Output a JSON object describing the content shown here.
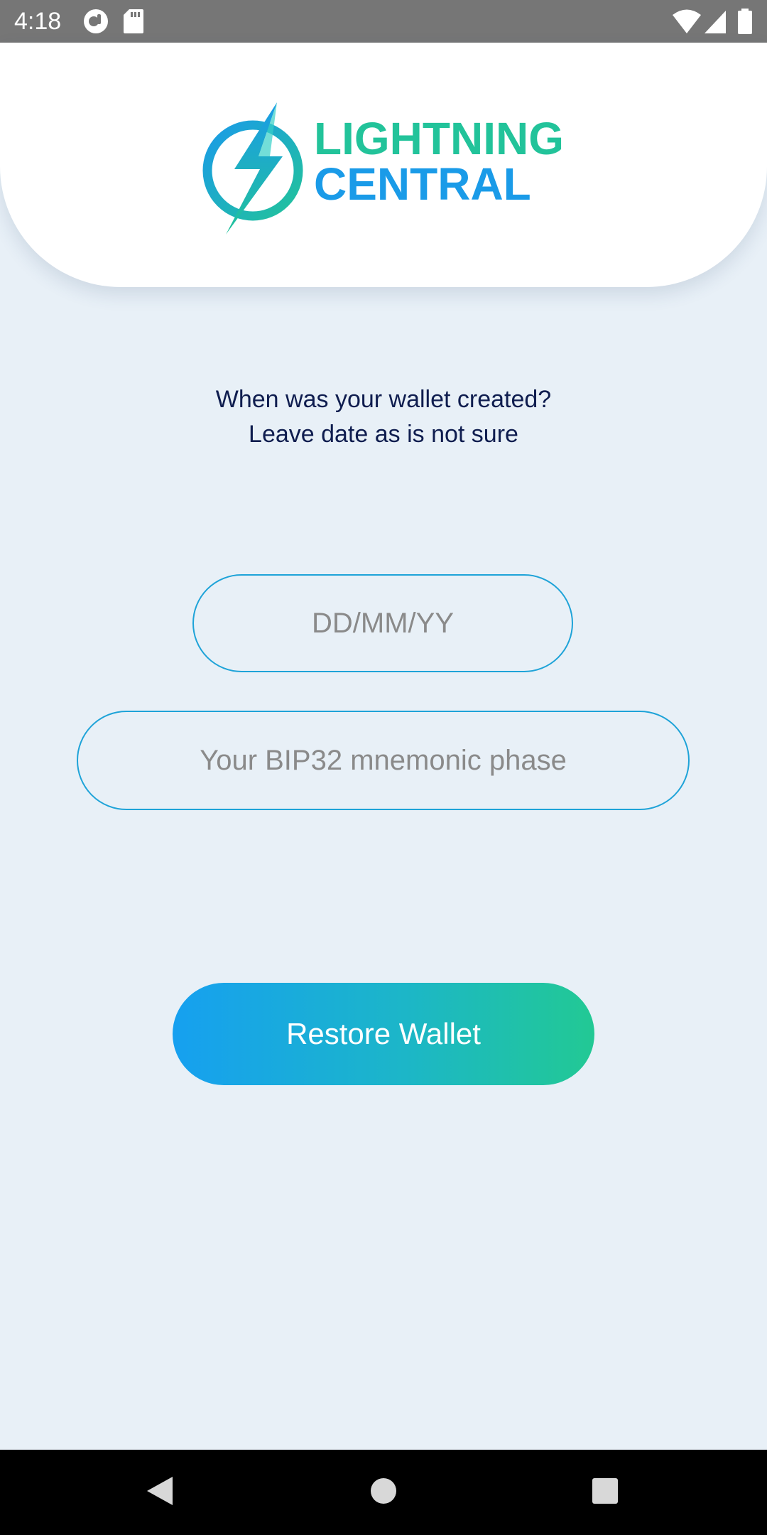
{
  "status_bar": {
    "time": "4:18",
    "left_icons": [
      "fdroid-icon",
      "sd-card-icon"
    ],
    "right_icons": [
      "wifi-icon",
      "cell-signal-icon",
      "battery-icon"
    ]
  },
  "header": {
    "logo_line1": "LIGHTNING",
    "logo_line2": "CENTRAL",
    "logo_icon": "lightning-bolt-icon"
  },
  "prompt": {
    "text": "When was your wallet created? Leave date as is not sure"
  },
  "date_field": {
    "value": "",
    "placeholder": "DD/MM/YY"
  },
  "mnemonic_field": {
    "value": "",
    "placeholder": "Your BIP32 mnemonic phase"
  },
  "restore_button": {
    "label": "Restore Wallet"
  },
  "nav_bar": {
    "icons": [
      "back-icon",
      "home-icon",
      "recents-icon"
    ]
  },
  "colors": {
    "accent_green": "#22c39a",
    "accent_blue": "#1a9be8",
    "field_border": "#1ea3d8",
    "background": "#e8f0f7",
    "text_dark": "#0f1d4f"
  }
}
